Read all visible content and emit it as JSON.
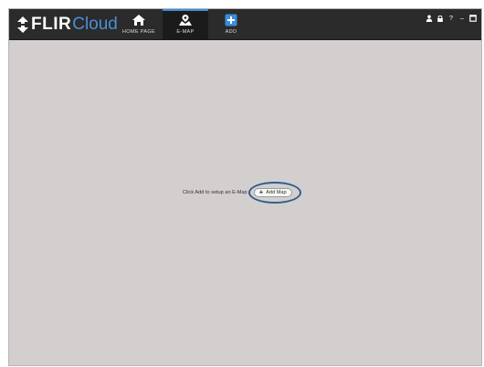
{
  "app": {
    "brand_primary": "FLIR",
    "brand_secondary": "Cloud",
    "brand_color": "#4a8fd8"
  },
  "nav": {
    "items": [
      {
        "label": "HOME PAGE",
        "icon": "home-icon",
        "active": false
      },
      {
        "label": "E-MAP",
        "icon": "map-pin-icon",
        "active": true
      },
      {
        "label": "ADD",
        "icon": "plus-square-icon",
        "active": false
      }
    ],
    "active_color": "#3a8edb"
  },
  "window_controls": {
    "icons": [
      "user-icon",
      "lock-icon",
      "help-icon",
      "minimize-icon",
      "maximize-icon"
    ],
    "help_glyph": "?",
    "minimize_glyph": "–"
  },
  "main": {
    "prompt": "Click Add to setup an E-Map",
    "add_map_button": "Add Map",
    "highlight_color": "#2f5f8f"
  }
}
